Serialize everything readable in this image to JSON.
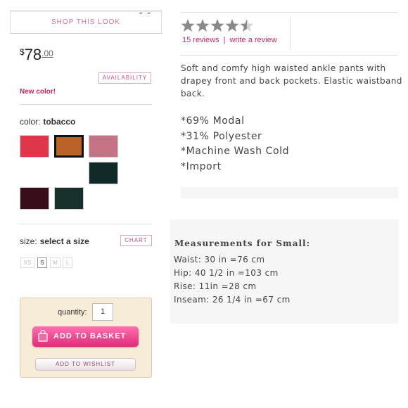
{
  "shop_look": {
    "label": "SHOP THIS LOOK"
  },
  "price": {
    "currency": "$",
    "dollars": "78",
    "cents": ".00"
  },
  "availability_label": "AVAILABILITY",
  "new_color_label": "New color!",
  "color": {
    "label": "color:",
    "selected": "tobacco",
    "swatches": [
      {
        "name": "red",
        "hex": "#e0364a"
      },
      {
        "name": "tobacco",
        "hex": "#b9622a",
        "selected": true
      },
      {
        "name": "mauve",
        "hex": "#c67386"
      },
      {
        "name": "dark-green",
        "hex": "#0f2a28"
      },
      {
        "name": "burgundy",
        "hex": "#3a0e18"
      },
      {
        "name": "forest",
        "hex": "#17302c"
      }
    ]
  },
  "size": {
    "label": "size:",
    "prompt": "select a size",
    "chart_label": "CHART",
    "options": [
      {
        "label": "XS",
        "available": false
      },
      {
        "label": "S",
        "available": true
      },
      {
        "label": "M",
        "available": false
      },
      {
        "label": "L",
        "available": false
      }
    ]
  },
  "basket": {
    "quantity_label": "quantity:",
    "quantity_value": "1",
    "add_label": "ADD TO BASKET",
    "wishlist_label": "ADD TO WISHLIST"
  },
  "rating": {
    "stars": 4.5,
    "reviews_link": "15 reviews",
    "separator": "|",
    "write_link": "write a review"
  },
  "description": "Soft and comfy high waisted ankle pants with drapey front and back pockets. Elastic waistband back.",
  "features": [
    "*69% Modal",
    "*31% Polyester",
    "*Machine Wash Cold",
    "*Import"
  ],
  "measurements": {
    "title": "Measurements for Small:",
    "lines": [
      "Waist: 30 in =76 cm",
      "Hip: 40 1/2 in =103 cm",
      "Rise: 11in =28 cm",
      "Inseam: 26 1/4 in =67 cm"
    ]
  },
  "colors": {
    "accent": "#c22a5c",
    "basket_button": "#e8408a",
    "panel_bg": "#f7ecd8"
  }
}
